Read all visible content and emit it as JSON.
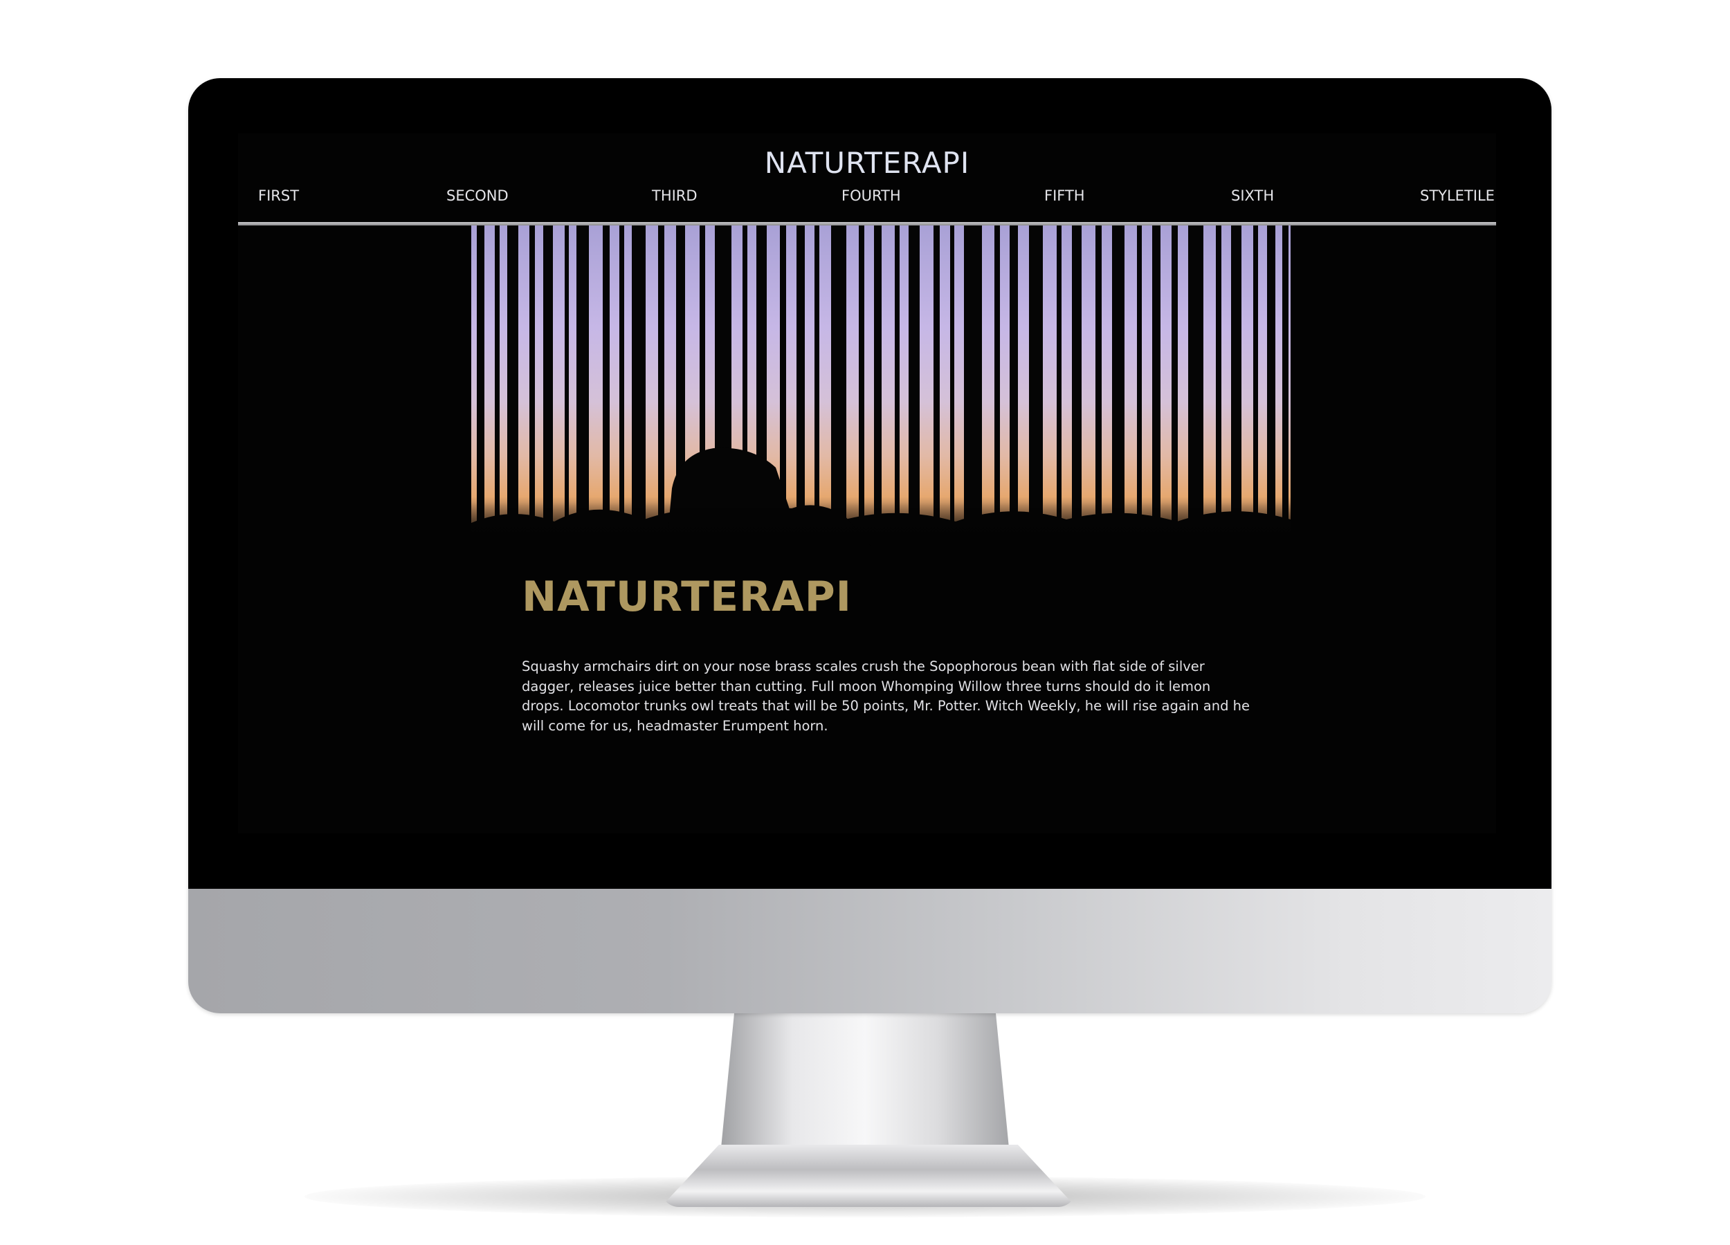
{
  "site": {
    "title": "NATURTERAPI"
  },
  "nav": {
    "items": [
      {
        "label": "FIRST"
      },
      {
        "label": "SECOND"
      },
      {
        "label": "THIRD"
      },
      {
        "label": "FOURTH"
      },
      {
        "label": "FIFTH"
      },
      {
        "label": "SIXTH"
      },
      {
        "label": "STYLETILE"
      }
    ]
  },
  "hero": {
    "image_description": "forest-silhouette-sunset"
  },
  "article": {
    "heading": "NATURTERAPI",
    "body": "Squashy armchairs dirt on your nose brass scales crush the Sopophorous bean with flat side of silver dagger, releases juice better than cutting. Full moon Whomping Willow three turns should do it lemon drops. Locomotor trunks owl treats that will be 50 points, Mr. Potter. Witch Weekly, he will rise again and he will come for us, headmaster Erumpent horn."
  },
  "colors": {
    "page_background": "#030303",
    "heading_accent": "#ae9860",
    "nav_text": "#e6e6ea",
    "monitor_chin": "#c8c9cc"
  }
}
